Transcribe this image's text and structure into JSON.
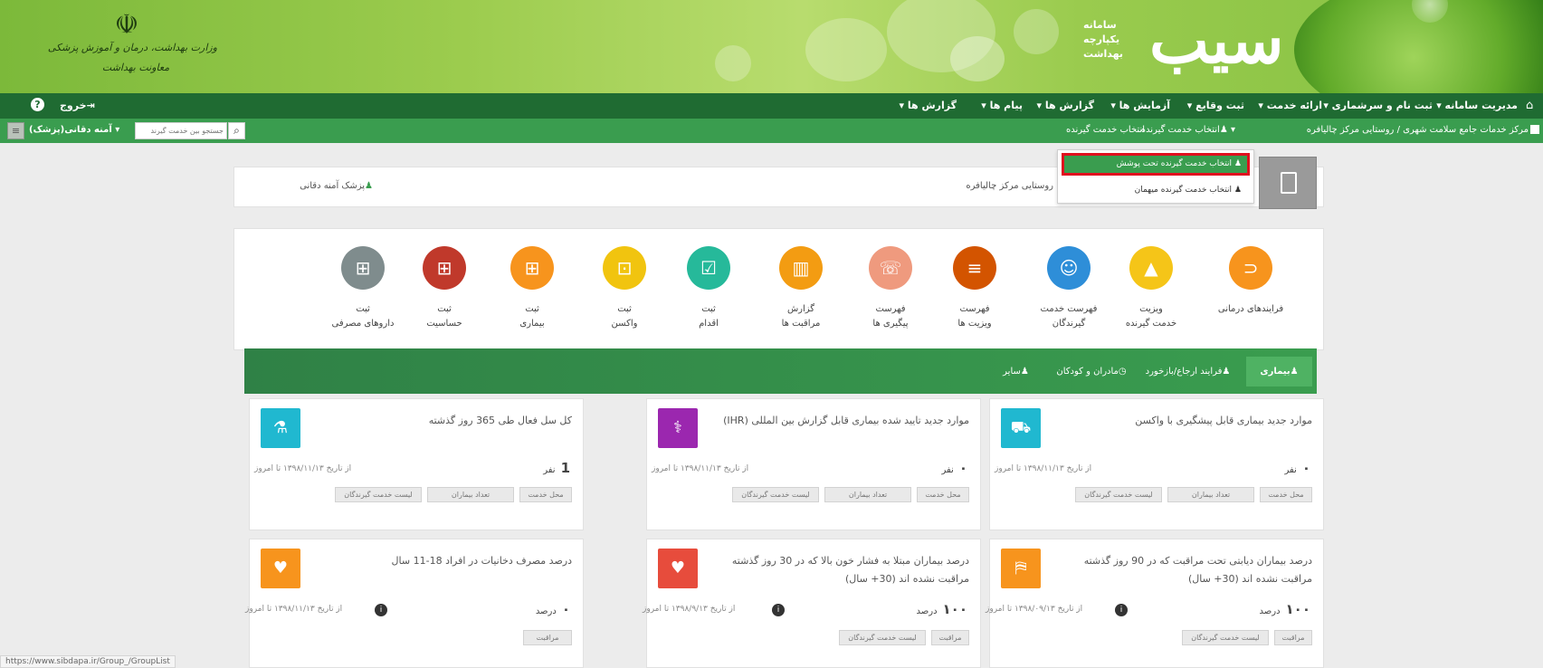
{
  "banner": {
    "brand_name": "سیب",
    "tagline": [
      "سامانه",
      "یکپارچه",
      "بهداشت"
    ],
    "ministry_lines": [
      "وزارت بهداشت، درمان و آموزش پزشکی",
      "معاونت بهداشت"
    ]
  },
  "menu": {
    "items": [
      "مدیریت سامانه ▾",
      "ثبت نام و سرشماری ▾",
      "ارائه خدمت ▾",
      "ثبت وقایع ▾",
      "آزمایش ها ▾",
      "گزارش ها ▾",
      "پیام ها ▾",
      "گزارش ها ▾"
    ],
    "logout": "خروج"
  },
  "subbar": {
    "center_path": "مرکز خدمات جامع سلامت شهری / روستایی مرکز چالیافره",
    "select_receiver": "انتخاب خدمت گیرنده",
    "search_placeholder": "جستجو بین خدمت گیرند",
    "user": "آمنه دقانی(پزشک)"
  },
  "dropdown": {
    "items": [
      "انتخاب خدمت گیرنده تحت پوشش",
      "انتخاب خدمت گیرنده میهمان"
    ]
  },
  "info": {
    "center": "روستایی مرکز چالیافره",
    "doctor": "پزشک آمنه دقانی"
  },
  "quick_actions": [
    {
      "label": [
        "فرایندهای درمانی",
        ""
      ],
      "color": "#f7941d"
    },
    {
      "label": [
        "ویزیت",
        "خدمت گیرنده"
      ],
      "color": "#f5c518"
    },
    {
      "label": [
        "فهرست خدمت",
        "گیرندگان"
      ],
      "color": "#2e8ed8"
    },
    {
      "label": [
        "فهرست",
        "ویزیت ها"
      ],
      "color": "#d35400"
    },
    {
      "label": [
        "فهرست",
        "پیگیری ها"
      ],
      "color": "#ef9a7e"
    },
    {
      "label": [
        "گزارش",
        "مراقبت ها"
      ],
      "color": "#f39c12"
    },
    {
      "label": [
        "ثبت",
        "اقدام"
      ],
      "color": "#26b99a"
    },
    {
      "label": [
        "ثبت",
        "واکسن"
      ],
      "color": "#f1c40f"
    },
    {
      "label": [
        "ثبت",
        "بیماری"
      ],
      "color": "#f7941d"
    },
    {
      "label": [
        "ثبت",
        "حساسیت"
      ],
      "color": "#c0392b"
    },
    {
      "label": [
        "ثبت",
        "داروهای مصرفی"
      ],
      "color": "#7f8c8d"
    }
  ],
  "tabs": [
    "بیماری",
    "فرایند ارجاع/بازخورد",
    "مادران و کودکان",
    "سایر"
  ],
  "tiles": [
    {
      "title": "موارد جدید بیماری قابل پیشگیری با واکسن",
      "count": "۰",
      "unit": "نفر",
      "date": "از تاریخ ۱۳۹۸/۱۱/۱۳ تا امروز",
      "buttons": [
        "محل خدمت",
        "تعداد بیماران",
        "لیست خدمت گیرندگان"
      ],
      "color": "#20b8d0"
    },
    {
      "title": "موارد جدید تایید شده بیماری قابل گزارش بین المللی (IHR)",
      "count": "۰",
      "unit": "نفر",
      "date": "از تاریخ ۱۳۹۸/۱۱/۱۳ تا امروز",
      "buttons": [
        "محل خدمت",
        "تعداد بیماران",
        "لیست خدمت گیرندگان"
      ],
      "color": "#9b27af"
    },
    {
      "title": "کل سل فعال طی 365 روز گذشته",
      "count": "1",
      "unit": "نفر",
      "date": "از تاریخ ۱۳۹۸/۱۱/۱۳ تا امروز",
      "buttons": [
        "محل خدمت",
        "تعداد بیماران",
        "لیست خدمت گیرندگان"
      ],
      "color": "#20b8d0"
    },
    {
      "title": "درصد بیماران دیابتی تحت مراقبت که در 90 روز گذشته مراقبت نشده اند (30+ سال)",
      "count": "۱۰۰",
      "unit": "درصد",
      "date": "از تاریخ ۱۳۹۸/۰۹/۱۳ تا امروز",
      "buttons": [
        "مراقبت",
        "لیست خدمت گیرندگان"
      ],
      "color": "#f7941d"
    },
    {
      "title": "درصد بیماران مبتلا به فشار خون بالا که در 30 روز گذشته مراقبت نشده اند (30+ سال)",
      "count": "۱۰۰",
      "unit": "درصد",
      "date": "از تاریخ ۱۳۹۸/۹/۱۳ تا امروز",
      "buttons": [
        "مراقبت",
        "لیست خدمت گیرندگان"
      ],
      "color": "#e74c3c"
    },
    {
      "title": "درصد مصرف دخانیات در افراد 18-11 سال",
      "count": "۰",
      "unit": "درصد",
      "date": "از تاریخ ۱۳۹۸/۱۱/۱۳ تا امروز",
      "buttons": [
        "مراقبت"
      ],
      "color": "#f7941d"
    }
  ],
  "status_url": "https://www.sibdapa.ir/Group_/GroupList"
}
